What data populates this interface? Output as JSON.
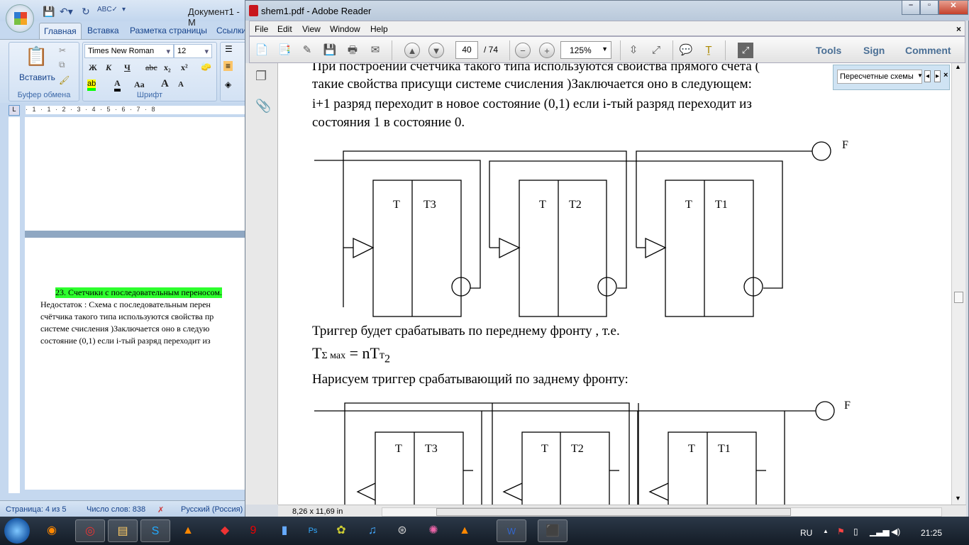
{
  "word": {
    "title": "Документ1 - M",
    "tabs": [
      "Главная",
      "Вставка",
      "Разметка страницы",
      "Ссылки"
    ],
    "clipboard": {
      "paste": "Вставить",
      "group": "Буфер обмена"
    },
    "font": {
      "name": "Times New Roman",
      "size": "12",
      "group": "Шрифт",
      "bold": "Ж",
      "italic": "К",
      "underline": "Ч",
      "strike": "abc",
      "sub": "x₂",
      "sup": "x²",
      "case": "Aa",
      "grow": "A",
      "shrink": "A"
    },
    "ruler": "· 1 · 1 · 2 · 3 · 4 · 5 · 6 · 7 · 8",
    "doc": {
      "heading": "23. Счетчики с последовательным переносом.",
      "lines": [
        "Недостаток : Схема с последовательным перен",
        "счётчика такого типа используются свойства пр",
        "системе счисления )Заключается оно в следую",
        "состояние (0,1) если i-тый разряд переходит из"
      ]
    },
    "status": {
      "page": "Страница: 4 из 5",
      "words": "Число слов: 838",
      "lang": "Русский (Россия)"
    }
  },
  "adobe": {
    "title": "shem1.pdf - Adobe Reader",
    "menu": [
      "File",
      "Edit",
      "View",
      "Window",
      "Help"
    ],
    "page_current": "40",
    "page_total": "/ 74",
    "zoom": "125%",
    "right_links": [
      "Tools",
      "Sign",
      "Comment"
    ],
    "find_text": "Пересчетные схемы",
    "page_size": "8,26 x 11,69 in",
    "content": {
      "lines": [
        "При построении счётчика такого типа используются свойства прямого счёта (",
        "такие свойства присущи системе счисления )Заключается оно в следующем:",
        "i+1 разряд переходит в новое состояние (0,1) если i-тый разряд переходит из",
        "состояния 1 в состояние 0."
      ],
      "diagram1": {
        "output": "F",
        "triggers": [
          {
            "t": "T",
            "name": "T3"
          },
          {
            "t": "T",
            "name": "T2"
          },
          {
            "t": "T",
            "name": "T1"
          }
        ]
      },
      "after1": "Триггер будет срабатывать по переднему фронту , т.е.",
      "formula": {
        "main": "T",
        "sub1": "Σ мах",
        "eq": " = nT",
        "sub2": "т",
        "sub3": "2"
      },
      "after2": "Нарисуем триггер срабатывающий по заднему фронту:",
      "diagram2": {
        "output": "F",
        "triggers": [
          {
            "t": "T",
            "name": "T3"
          },
          {
            "t": "T",
            "name": "T2"
          },
          {
            "t": "T",
            "name": "T1"
          }
        ]
      }
    }
  },
  "taskbar": {
    "lang": "RU",
    "time": "21:25"
  }
}
